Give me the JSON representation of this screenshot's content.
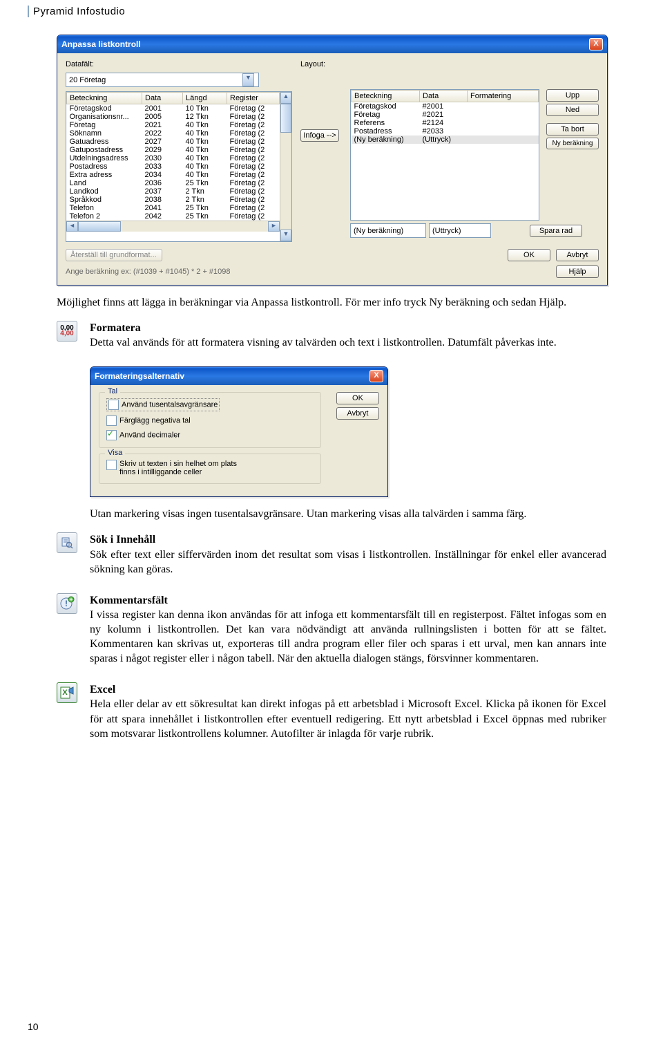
{
  "header": "Pyramid Infostudio",
  "page_number": "10",
  "dialog1": {
    "title": "Anpassa listkontroll",
    "datafalt_label": "Datafält:",
    "layout_label": "Layout:",
    "datafalt_value": "20 Företag",
    "left_headers": [
      "Beteckning",
      "Data",
      "Längd",
      "Register"
    ],
    "left_rows": [
      [
        "Företagskod",
        "2001",
        "10 Tkn",
        "Företag (2"
      ],
      [
        "Organisationsnr...",
        "2005",
        "12 Tkn",
        "Företag (2"
      ],
      [
        "Företag",
        "2021",
        "40 Tkn",
        "Företag (2"
      ],
      [
        "Söknamn",
        "2022",
        "40 Tkn",
        "Företag (2"
      ],
      [
        "Gatuadress",
        "2027",
        "40 Tkn",
        "Företag (2"
      ],
      [
        "Gatupostadress",
        "2029",
        "40 Tkn",
        "Företag (2"
      ],
      [
        "Utdelningsadress",
        "2030",
        "40 Tkn",
        "Företag (2"
      ],
      [
        "Postadress",
        "2033",
        "40 Tkn",
        "Företag (2"
      ],
      [
        "Extra adress",
        "2034",
        "40 Tkn",
        "Företag (2"
      ],
      [
        "Land",
        "2036",
        "25 Tkn",
        "Företag (2"
      ],
      [
        "Landkod",
        "2037",
        "2 Tkn",
        "Företag (2"
      ],
      [
        "Språkkod",
        "2038",
        "2 Tkn",
        "Företag (2"
      ],
      [
        "Telefon",
        "2041",
        "25 Tkn",
        "Företag (2"
      ],
      [
        "Telefon 2",
        "2042",
        "25 Tkn",
        "Företag (2"
      ]
    ],
    "infoga_btn": "Infoga -->",
    "right_headers": [
      "Beteckning",
      "Data",
      "Formatering"
    ],
    "right_rows": [
      [
        "Företagskod",
        "#2001",
        ""
      ],
      [
        "Företag",
        "#2021",
        ""
      ],
      [
        "Referens",
        "#2124",
        ""
      ],
      [
        "Postadress",
        "#2033",
        ""
      ],
      [
        "(Ny beräkning)",
        "(Uttryck)",
        ""
      ]
    ],
    "right_input1": "(Ny beräkning)",
    "right_input2": "(Uttryck)",
    "side_buttons": {
      "upp": "Upp",
      "ned": "Ned",
      "tabort": "Ta bort",
      "nyber": "Ny beräkning",
      "spara": "Spara rad"
    },
    "footer": {
      "aterstall": "Återställ till grundformat...",
      "ange": "Ange beräkning ex: (#1039 + #1045) * 2 + #1098",
      "ok": "OK",
      "avbryt": "Avbryt",
      "hjalp": "Hjälp"
    }
  },
  "paragraph_after_d1": "Möjlighet finns att lägga in beräkningar via Anpassa listkontroll. För mer info tryck Ny beräkning och sedan Hjälp.",
  "section_formatera": {
    "title": "Formatera",
    "text": "Detta val används för att formatera visning av talvärden och text i listkontrollen. Datumfält påverkas inte."
  },
  "dialog2": {
    "title": "Formateringsalternativ",
    "tal_legend": "Tal",
    "visa_legend": "Visa",
    "chk1": "Använd tusentalsavgränsare",
    "chk2": "Färglägg negativa tal",
    "chk3": "Använd decimaler",
    "chk4": "Skriv ut texten i sin helhet om plats finns i intilliggande celler",
    "ok": "OK",
    "avbryt": "Avbryt"
  },
  "paragraph_after_d2": "Utan markering visas ingen tusentalsavgränsare. Utan markering visas alla talvärden i samma färg.",
  "section_sok": {
    "title": "Sök i Innehåll",
    "text": "Sök efter text eller siffervärden inom det resultat som visas i listkontrollen. Inställningar för enkel eller avancerad sökning kan göras."
  },
  "section_kommentar": {
    "title": "Kommentarsfält",
    "text": "I vissa register kan denna ikon användas för att infoga ett kommentarsfält till en registerpost. Fältet infogas som en ny kolumn i listkontrollen. Det kan vara nödvändigt att använda rullningslisten i botten för att se fältet. Kommentaren kan skrivas ut, exporteras till andra program eller filer och sparas i ett urval, men kan annars inte sparas i något register eller i någon tabell. När den aktuella dialogen stängs, försvinner kommentaren."
  },
  "section_excel": {
    "title": "Excel",
    "text": "Hela eller delar av ett sökresultat kan direkt infogas på ett arbetsblad i Microsoft Excel. Klicka på ikonen för Excel för att spara innehållet i listkontrollen efter eventuell redigering. Ett nytt arbetsblad i Excel öppnas med rubriker som motsvarar listkontrollens kolumner. Autofilter är inlagda för varje rubrik."
  }
}
